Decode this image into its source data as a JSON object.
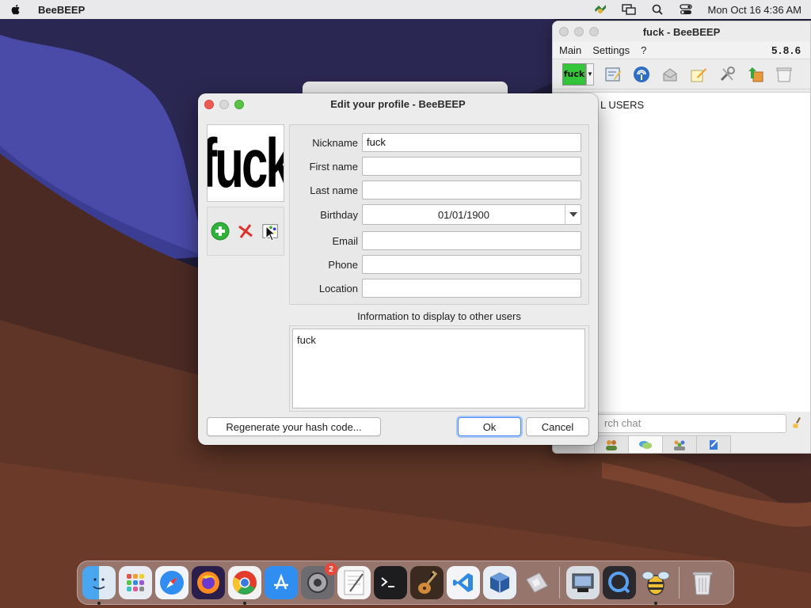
{
  "menubar": {
    "app_name": "BeeBEEP",
    "clock": "Mon Oct 16  4:36 AM"
  },
  "main_window": {
    "title": "fuck - BeeBEEP",
    "menu": [
      "Main",
      "Settings",
      "?"
    ],
    "version": "5.8.6",
    "status_label": "fuck",
    "userlist_header": "L USERS",
    "search_placeholder": "rch chat"
  },
  "dialog": {
    "title": "Edit your profile - BeeBEEP",
    "avatar_text": "fuck",
    "fields": {
      "nickname": {
        "label": "Nickname",
        "value": "fuck"
      },
      "first_name": {
        "label": "First name",
        "value": ""
      },
      "last_name": {
        "label": "Last name",
        "value": ""
      },
      "birthday": {
        "label": "Birthday",
        "value": "01/01/1900"
      },
      "email": {
        "label": "Email",
        "value": ""
      },
      "phone": {
        "label": "Phone",
        "value": ""
      },
      "location": {
        "label": "Location",
        "value": ""
      }
    },
    "info_label": "Information to display to other users",
    "info_text": "fuck",
    "buttons": {
      "regenerate": "Regenerate your hash code...",
      "ok": "Ok",
      "cancel": "Cancel"
    }
  },
  "dock": {
    "apps": [
      "Finder",
      "Launchpad",
      "Safari",
      "Firefox",
      "Chrome",
      "App Store",
      "System Settings",
      "TextEdit",
      "Terminal",
      "GarageBand",
      "VS Code",
      "VirtualBox",
      "Preview",
      "Automator",
      "QuickTime",
      "BeeBEEP",
      "Trash"
    ],
    "settings_badge": "2"
  },
  "colors": {
    "status_green": "#34c73a",
    "ok_focus": "#4b8df1",
    "close_red": "#ee5b53",
    "zoom_green": "#5ac244"
  }
}
